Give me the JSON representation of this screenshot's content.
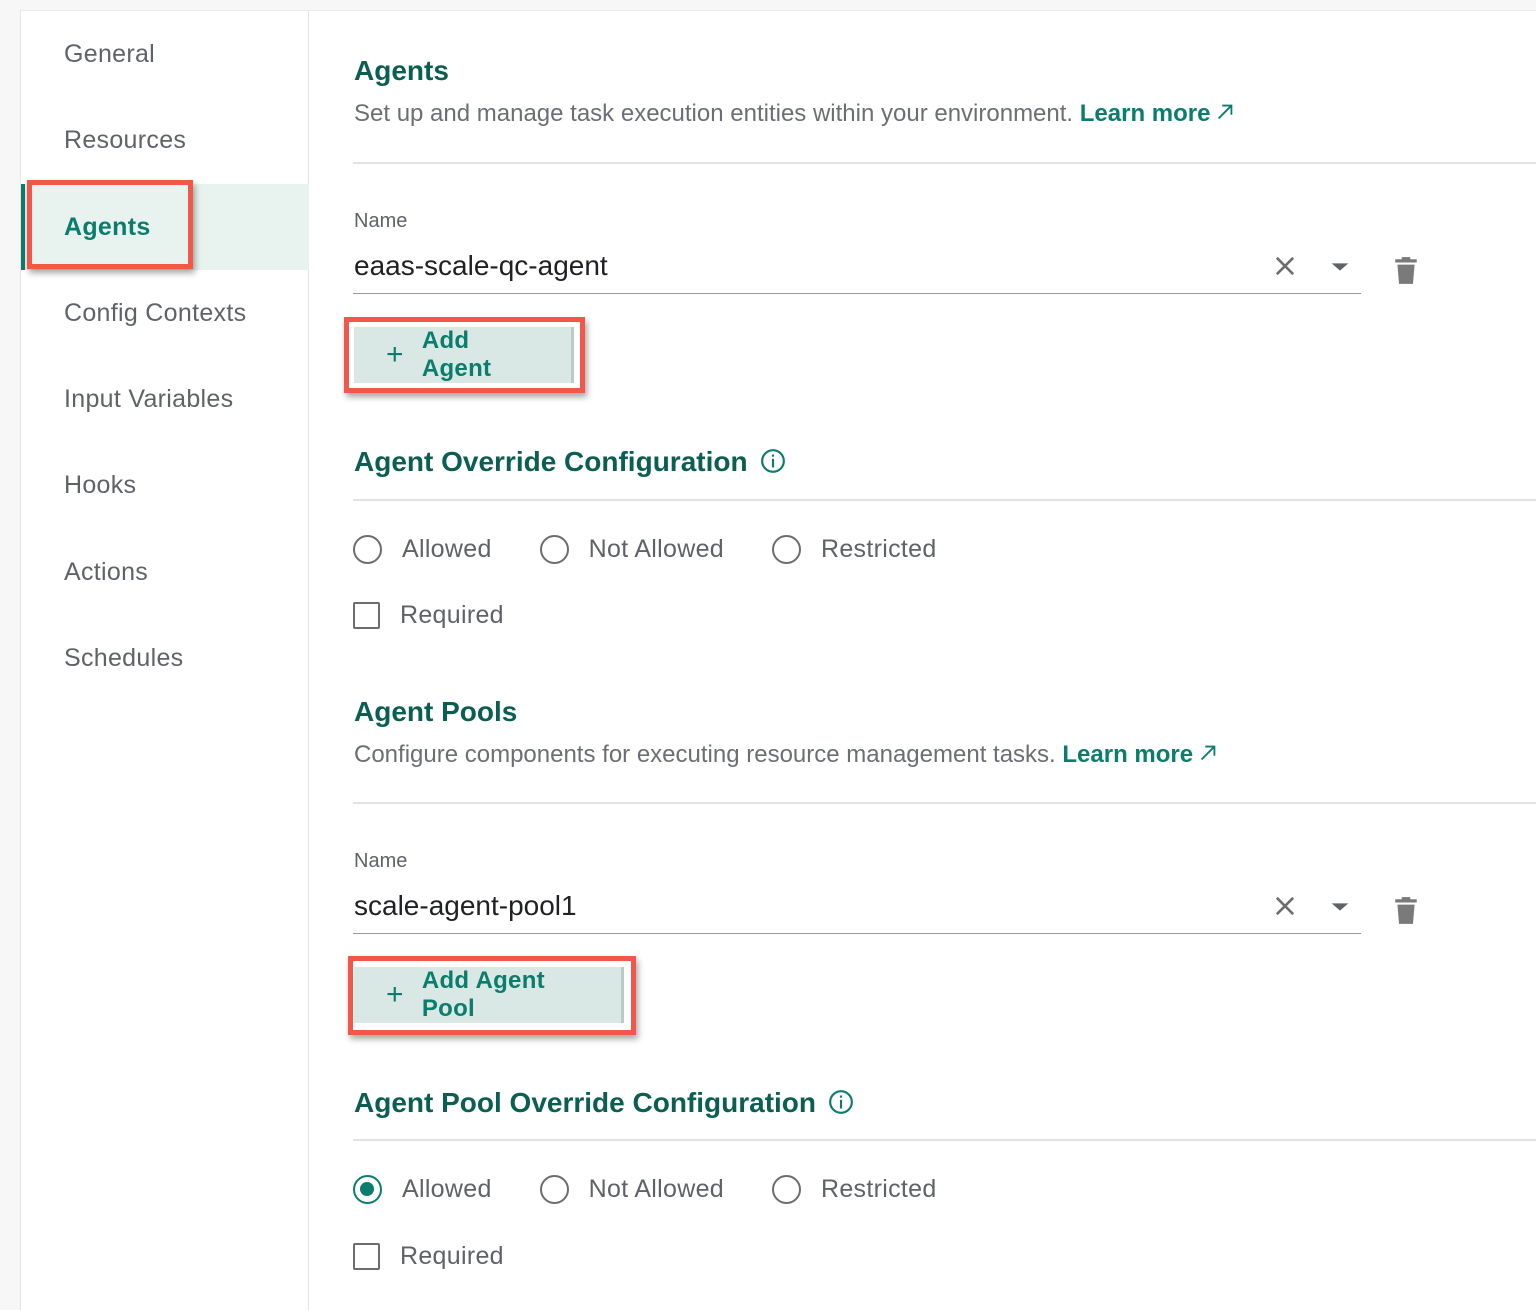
{
  "sidebar": {
    "items": [
      {
        "label": "General"
      },
      {
        "label": "Resources"
      },
      {
        "label": "Agents",
        "active": true
      },
      {
        "label": "Config Contexts"
      },
      {
        "label": "Input Variables"
      },
      {
        "label": "Hooks"
      },
      {
        "label": "Actions"
      },
      {
        "label": "Schedules"
      }
    ]
  },
  "agents": {
    "title": "Agents",
    "description": "Set up and manage task execution entities within your environment.",
    "learn_more": "Learn more",
    "name_label": "Name",
    "name_value": "eaas-scale-qc-agent",
    "add_button": "Add Agent"
  },
  "agent_override": {
    "title": "Agent Override Configuration",
    "options": [
      "Allowed",
      "Not Allowed",
      "Restricted"
    ],
    "selected": null,
    "required_label": "Required",
    "required_checked": false
  },
  "agent_pools": {
    "title": "Agent Pools",
    "description": "Configure components for executing resource management tasks.",
    "learn_more": "Learn more",
    "name_label": "Name",
    "name_value": "scale-agent-pool1",
    "add_button": "Add Agent Pool"
  },
  "agent_pool_override": {
    "title": "Agent Pool Override Configuration",
    "options": [
      "Allowed",
      "Not Allowed",
      "Restricted"
    ],
    "selected": "Allowed",
    "required_label": "Required",
    "required_checked": false
  },
  "colors": {
    "accent": "#0b7d6c",
    "heading": "#0b5f52",
    "highlight": "#f2574a",
    "active_bg": "#e8f2ef",
    "button_bg": "#d9e8e5"
  },
  "icons": [
    "external-link-icon",
    "clear-icon",
    "chevron-down-icon",
    "trash-icon",
    "plus-icon",
    "info-icon"
  ]
}
